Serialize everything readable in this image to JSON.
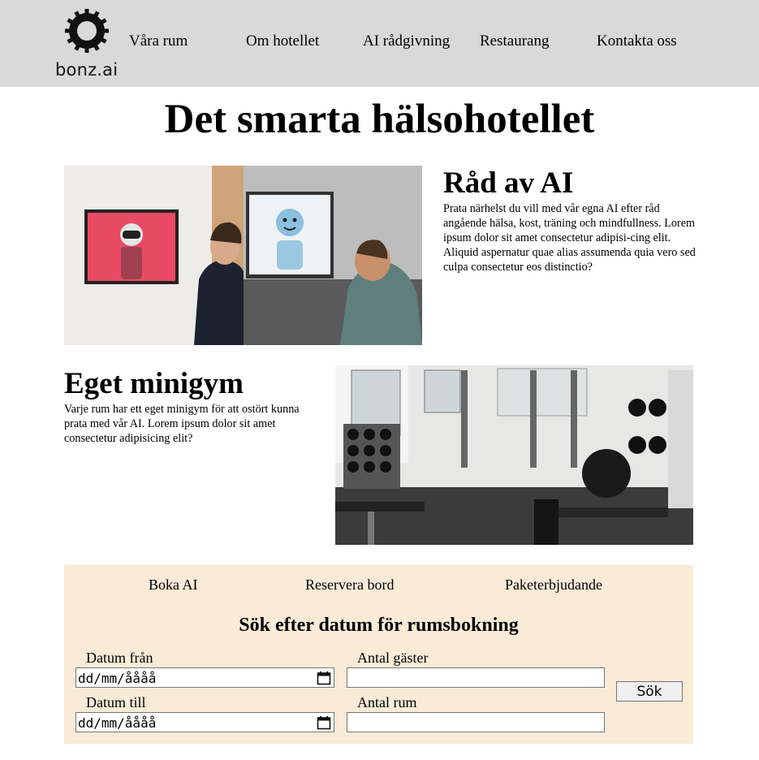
{
  "header": {
    "logo_text": "bonz.ai",
    "nav": [
      "Våra rum",
      "Om hotellet",
      "AI rådgivning",
      "Restaurang",
      "Kontakta oss"
    ]
  },
  "page_title": "Det smarta hälsohotellet",
  "ai_section": {
    "heading": "Råd av AI",
    "text": "Prata närhelst du vill med vår egna AI efter råd angående hälsa, kost, träning och mindfullness. Lorem ipsum dolor sit amet consectetur adipisi-cing elit. Aliquid aspernatur quae alias assumenda quia vero sed culpa consectetur eos distinctio?"
  },
  "gym_section": {
    "heading": "Eget minigym",
    "text": "Varje rum har ett eget minigym för att ostört kunna prata med vår AI. Lorem ipsum dolor sit amet consectetur adipisicing elit?"
  },
  "booking": {
    "links": [
      "Boka AI",
      "Reservera bord",
      "Paketerbjudande"
    ],
    "title": "Sök efter datum för rumsbokning",
    "date_from_label": "Datum från",
    "date_to_label": "Datum till",
    "guests_label": "Antal gäster",
    "rooms_label": "Antal rum",
    "date_placeholder": "dd/mm/åååå",
    "guests_value": "",
    "rooms_value": "",
    "search_label": "Sök"
  },
  "colors": {
    "header_bg": "#d9d9d9",
    "booking_bg": "#faebd7"
  }
}
